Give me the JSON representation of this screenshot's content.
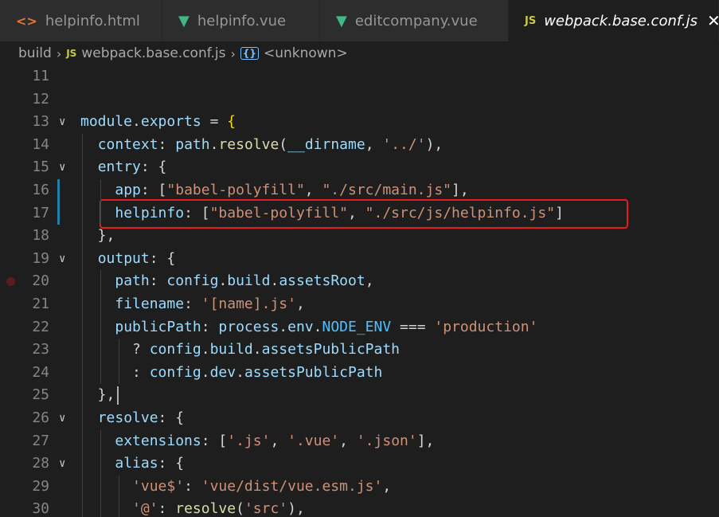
{
  "tabs": [
    {
      "label": "helpinfo.html",
      "icon": "html-file-icon",
      "icon_glyph": "<>",
      "active": false
    },
    {
      "label": "helpinfo.vue",
      "icon": "vue-file-icon",
      "icon_glyph": "▼",
      "active": false
    },
    {
      "label": "editcompany.vue",
      "icon": "vue-file-icon",
      "icon_glyph": "▼",
      "active": false
    },
    {
      "label": "webpack.base.conf.js",
      "icon": "js-file-icon",
      "icon_glyph": "JS",
      "active": true
    }
  ],
  "breadcrumb": {
    "folder": "build",
    "file_icon": "JS",
    "file": "webpack.base.conf.js",
    "symbol": "<unknown>"
  },
  "lines": [
    {
      "n": "11",
      "tokens": []
    },
    {
      "n": "12",
      "tokens": []
    },
    {
      "n": "13",
      "fold": true,
      "tokens": [
        [
          "module",
          "k"
        ],
        [
          ".",
          "p"
        ],
        [
          "exports",
          "k"
        ],
        [
          " = ",
          "p"
        ],
        [
          "{",
          "b"
        ]
      ]
    },
    {
      "n": "14",
      "tokens": [
        [
          "  ",
          "p"
        ],
        [
          "context",
          "k"
        ],
        [
          ": ",
          "p"
        ],
        [
          "path",
          "k"
        ],
        [
          ".",
          "p"
        ],
        [
          "resolve",
          "f"
        ],
        [
          "(",
          "p"
        ],
        [
          "__dirname",
          "k"
        ],
        [
          ", ",
          "p"
        ],
        [
          "'../'",
          "s"
        ],
        [
          "),",
          "p"
        ]
      ]
    },
    {
      "n": "15",
      "fold": true,
      "tokens": [
        [
          "  ",
          "p"
        ],
        [
          "entry",
          "k"
        ],
        [
          ": {",
          "p"
        ]
      ]
    },
    {
      "n": "16",
      "tokens": [
        [
          "    ",
          "p"
        ],
        [
          "app",
          "k"
        ],
        [
          ": [",
          "p"
        ],
        [
          "\"babel-polyfill\"",
          "s"
        ],
        [
          ", ",
          "p"
        ],
        [
          "\"./src/main.js\"",
          "s"
        ],
        [
          "],",
          "p"
        ]
      ]
    },
    {
      "n": "17",
      "tokens": [
        [
          "    ",
          "p"
        ],
        [
          "helpinfo",
          "k"
        ],
        [
          ": [",
          "p"
        ],
        [
          "\"babel-polyfill\"",
          "s"
        ],
        [
          ", ",
          "p"
        ],
        [
          "\"./src/js/helpinfo.js\"",
          "s"
        ],
        [
          "]",
          "p"
        ]
      ]
    },
    {
      "n": "18",
      "tokens": [
        [
          "  },",
          "p"
        ]
      ]
    },
    {
      "n": "19",
      "fold": true,
      "tokens": [
        [
          "  ",
          "p"
        ],
        [
          "output",
          "k"
        ],
        [
          ": {",
          "p"
        ]
      ]
    },
    {
      "n": "20",
      "tokens": [
        [
          "    ",
          "p"
        ],
        [
          "path",
          "k"
        ],
        [
          ": ",
          "p"
        ],
        [
          "config",
          "k"
        ],
        [
          ".",
          "p"
        ],
        [
          "build",
          "k"
        ],
        [
          ".",
          "p"
        ],
        [
          "assetsRoot",
          "k"
        ],
        [
          ",",
          "p"
        ]
      ]
    },
    {
      "n": "21",
      "tokens": [
        [
          "    ",
          "p"
        ],
        [
          "filename",
          "k"
        ],
        [
          ": ",
          "p"
        ],
        [
          "'[name].js'",
          "s"
        ],
        [
          ",",
          "p"
        ]
      ]
    },
    {
      "n": "22",
      "tokens": [
        [
          "    ",
          "p"
        ],
        [
          "publicPath",
          "k"
        ],
        [
          ": ",
          "p"
        ],
        [
          "process",
          "k"
        ],
        [
          ".",
          "p"
        ],
        [
          "env",
          "k"
        ],
        [
          ".",
          "p"
        ],
        [
          "NODE_ENV",
          "v"
        ],
        [
          " === ",
          "p"
        ],
        [
          "'production'",
          "s"
        ]
      ]
    },
    {
      "n": "23",
      "tokens": [
        [
          "      ? ",
          "p"
        ],
        [
          "config",
          "k"
        ],
        [
          ".",
          "p"
        ],
        [
          "build",
          "k"
        ],
        [
          ".",
          "p"
        ],
        [
          "assetsPublicPath",
          "k"
        ]
      ]
    },
    {
      "n": "24",
      "tokens": [
        [
          "      : ",
          "p"
        ],
        [
          "config",
          "k"
        ],
        [
          ".",
          "p"
        ],
        [
          "dev",
          "k"
        ],
        [
          ".",
          "p"
        ],
        [
          "assetsPublicPath",
          "k"
        ]
      ]
    },
    {
      "n": "25",
      "tokens": [
        [
          "  },",
          "p"
        ]
      ]
    },
    {
      "n": "26",
      "fold": true,
      "tokens": [
        [
          "  ",
          "p"
        ],
        [
          "resolve",
          "k"
        ],
        [
          ": {",
          "p"
        ]
      ]
    },
    {
      "n": "27",
      "tokens": [
        [
          "    ",
          "p"
        ],
        [
          "extensions",
          "k"
        ],
        [
          ": [",
          "p"
        ],
        [
          "'.js'",
          "s"
        ],
        [
          ", ",
          "p"
        ],
        [
          "'.vue'",
          "s"
        ],
        [
          ", ",
          "p"
        ],
        [
          "'.json'",
          "s"
        ],
        [
          "],",
          "p"
        ]
      ]
    },
    {
      "n": "28",
      "fold": true,
      "tokens": [
        [
          "    ",
          "p"
        ],
        [
          "alias",
          "k"
        ],
        [
          ": {",
          "p"
        ]
      ]
    },
    {
      "n": "29",
      "tokens": [
        [
          "      ",
          "p"
        ],
        [
          "'vue$'",
          "s"
        ],
        [
          ": ",
          "p"
        ],
        [
          "'vue/dist/vue.esm.js'",
          "s"
        ],
        [
          ",",
          "p"
        ]
      ]
    },
    {
      "n": "30",
      "tokens": [
        [
          "      ",
          "p"
        ],
        [
          "'@'",
          "s"
        ],
        [
          ": ",
          "p"
        ],
        [
          "resolve",
          "f"
        ],
        [
          "(",
          "p"
        ],
        [
          "'src'",
          "s"
        ],
        [
          "),",
          "p"
        ]
      ]
    }
  ],
  "modified_lines": [
    "16",
    "17"
  ],
  "breakpoint_line": "20",
  "colors": {
    "property": "#9cdcfe",
    "string": "#ce9178",
    "function": "#dcdcaa",
    "constant": "#4fc1ff",
    "highlight_box": "#e51c1c"
  }
}
